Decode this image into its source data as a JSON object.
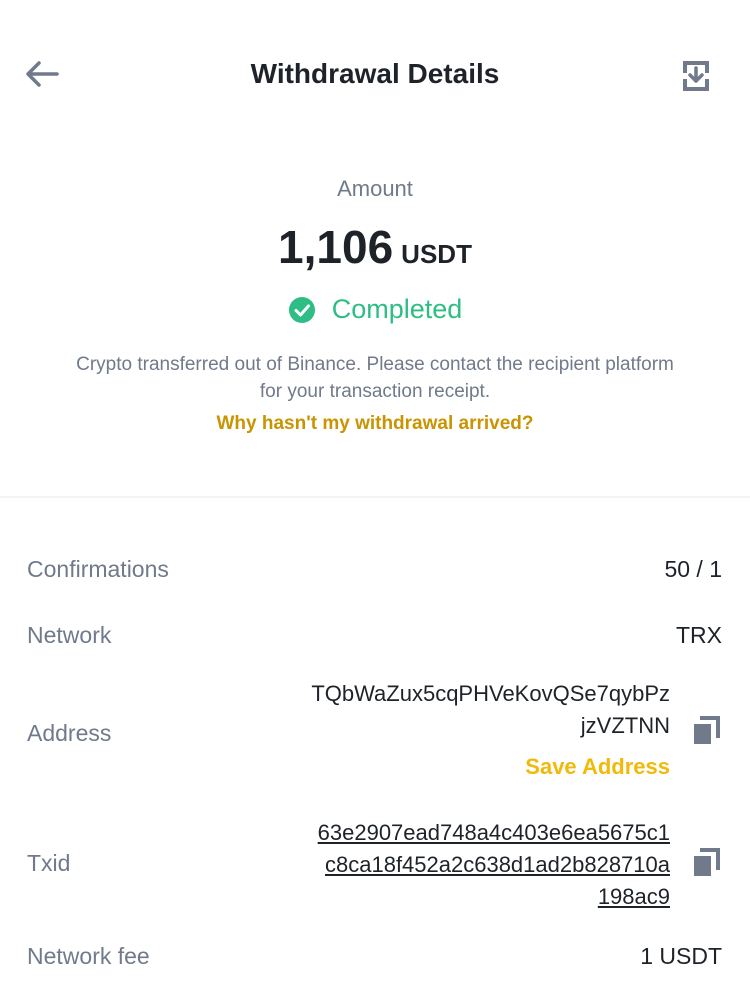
{
  "header": {
    "title": "Withdrawal Details",
    "back_icon": "arrow-left-icon",
    "download_icon": "download-icon"
  },
  "summary": {
    "amount_label": "Amount",
    "amount_value": "1,106",
    "amount_unit": "USDT",
    "status": "Completed",
    "status_icon": "check-circle-icon",
    "status_color": "#2ebd85",
    "notice_line1": "Crypto transferred out of Binance. Please contact the recipient platform",
    "notice_line2": "for your transaction receipt.",
    "help_link": "Why hasn't my withdrawal arrived?"
  },
  "details": {
    "confirmations_label": "Confirmations",
    "confirmations_value": "50 / 1",
    "network_label": "Network",
    "network_value": "TRX",
    "address_label": "Address",
    "address_line1": "TQbWaZux5cqPHVeKovQSe7qybPz",
    "address_line2": "jzVZTNN",
    "save_address": "Save Address",
    "txid_label": "Txid",
    "txid_line1": "63e2907ead748a4c403e6ea5675c1",
    "txid_line2": "c8ca18f452a2c638d1ad2b828710a",
    "txid_line3": "198ac9",
    "fee_label": "Network fee",
    "fee_value": "1 USDT",
    "copy_icon": "copy-icon"
  },
  "colors": {
    "accent_yellow": "#f0b90b",
    "link_gold": "#c99400",
    "success_green": "#2ebd85",
    "muted_text": "#707a8a"
  }
}
